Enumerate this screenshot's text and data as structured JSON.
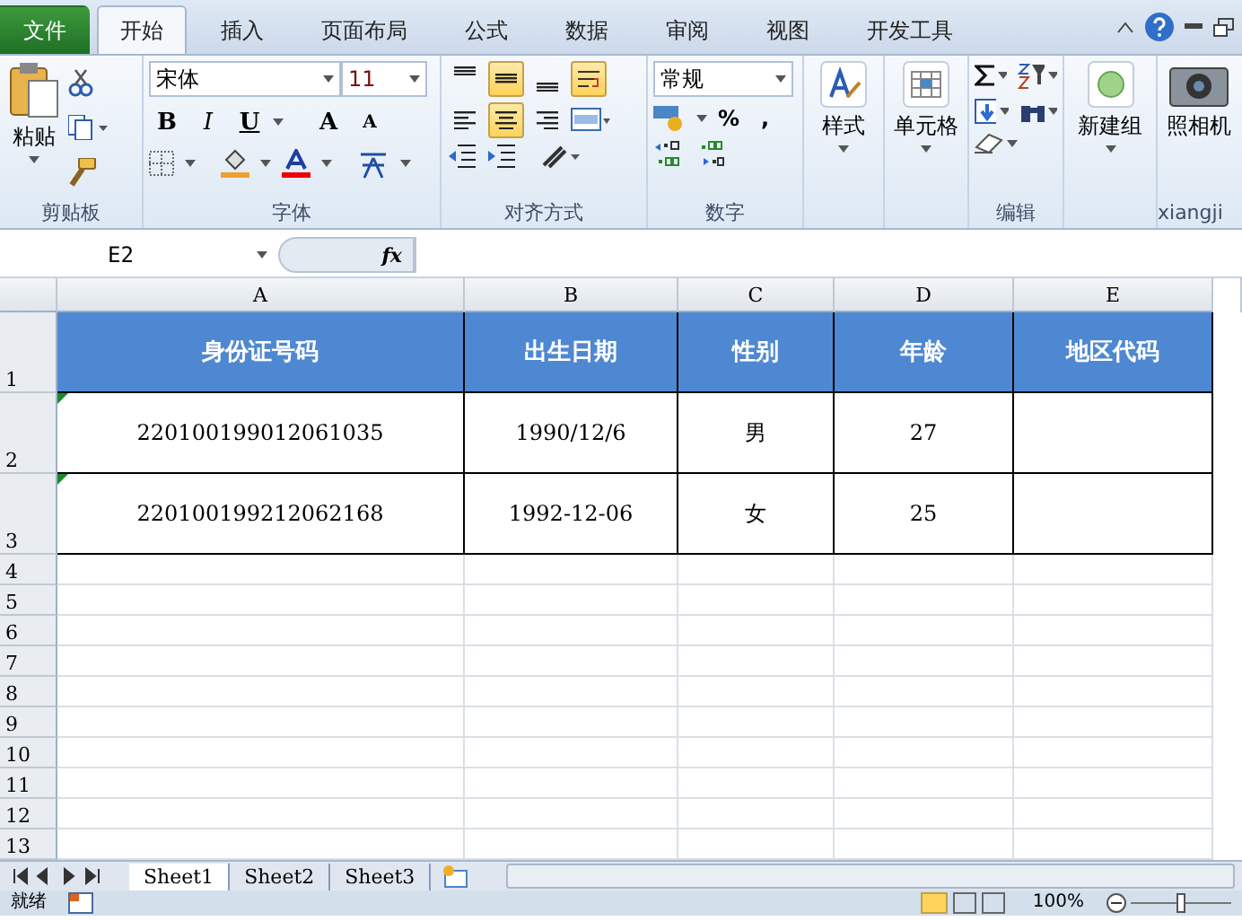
{
  "ribbon_tabs": [
    {
      "label": "文件",
      "kind": "file",
      "selected": false
    },
    {
      "label": "开始",
      "kind": "tab",
      "selected": true
    },
    {
      "label": "插入",
      "kind": "tab",
      "selected": false
    },
    {
      "label": "页面布局",
      "kind": "tab",
      "selected": false
    },
    {
      "label": "公式",
      "kind": "tab",
      "selected": false
    },
    {
      "label": "数据",
      "kind": "tab",
      "selected": false
    },
    {
      "label": "审阅",
      "kind": "tab",
      "selected": false
    },
    {
      "label": "视图",
      "kind": "tab",
      "selected": false
    },
    {
      "label": "开发工具",
      "kind": "tab",
      "selected": false
    }
  ],
  "clipboard": {
    "paste": "粘贴",
    "label": "剪贴板"
  },
  "font": {
    "name": "宋体",
    "size": "11",
    "bold": "B",
    "italic": "I",
    "underline": "U",
    "grow": "A",
    "shrink": "A",
    "label": "字体"
  },
  "alignment": {
    "vertical": [
      {
        "kind": "top",
        "selected": false
      },
      {
        "kind": "middle",
        "selected": true
      },
      {
        "kind": "bottom",
        "selected": false
      }
    ],
    "horizontal": [
      {
        "kind": "left",
        "selected": false
      },
      {
        "kind": "center",
        "selected": true
      },
      {
        "kind": "right",
        "selected": false
      }
    ],
    "wrap_selected": true,
    "label": "对齐方式"
  },
  "number": {
    "format": "常规",
    "percent": "%",
    "comma": ",",
    "label": "数字"
  },
  "big_buttons": [
    {
      "label": "样式",
      "kind": "styles"
    },
    {
      "label": "单元格",
      "kind": "cells"
    }
  ],
  "editing": {
    "label": "编辑"
  },
  "new_group": {
    "label": "新建组"
  },
  "camera": {
    "button": "照相机",
    "label": "xiangji"
  },
  "name_box": "E2",
  "formula_label": "fx",
  "columns": [
    "A",
    "B",
    "C",
    "D",
    "E"
  ],
  "header_row": {
    "number": "1",
    "cells": [
      "身份证号码",
      "出生日期",
      "性别",
      "年龄",
      "地区代码"
    ]
  },
  "rows": [
    {
      "number": "2",
      "flag": true,
      "cells": [
        "220100199012061035",
        "1990/12/6",
        "男",
        "27",
        ""
      ]
    },
    {
      "number": "3",
      "flag": true,
      "cells": [
        "220100199212062168",
        "1992-12-06",
        "女",
        "25",
        ""
      ]
    }
  ],
  "empty_rows": [
    "4",
    "5",
    "6",
    "7",
    "8",
    "9",
    "10",
    "11",
    "12",
    "13"
  ],
  "sheets": [
    {
      "label": "Sheet1",
      "selected": true
    },
    {
      "label": "Sheet2",
      "selected": false
    },
    {
      "label": "Sheet3",
      "selected": false
    }
  ],
  "status": {
    "text": "就绪",
    "zoom": "100%"
  }
}
